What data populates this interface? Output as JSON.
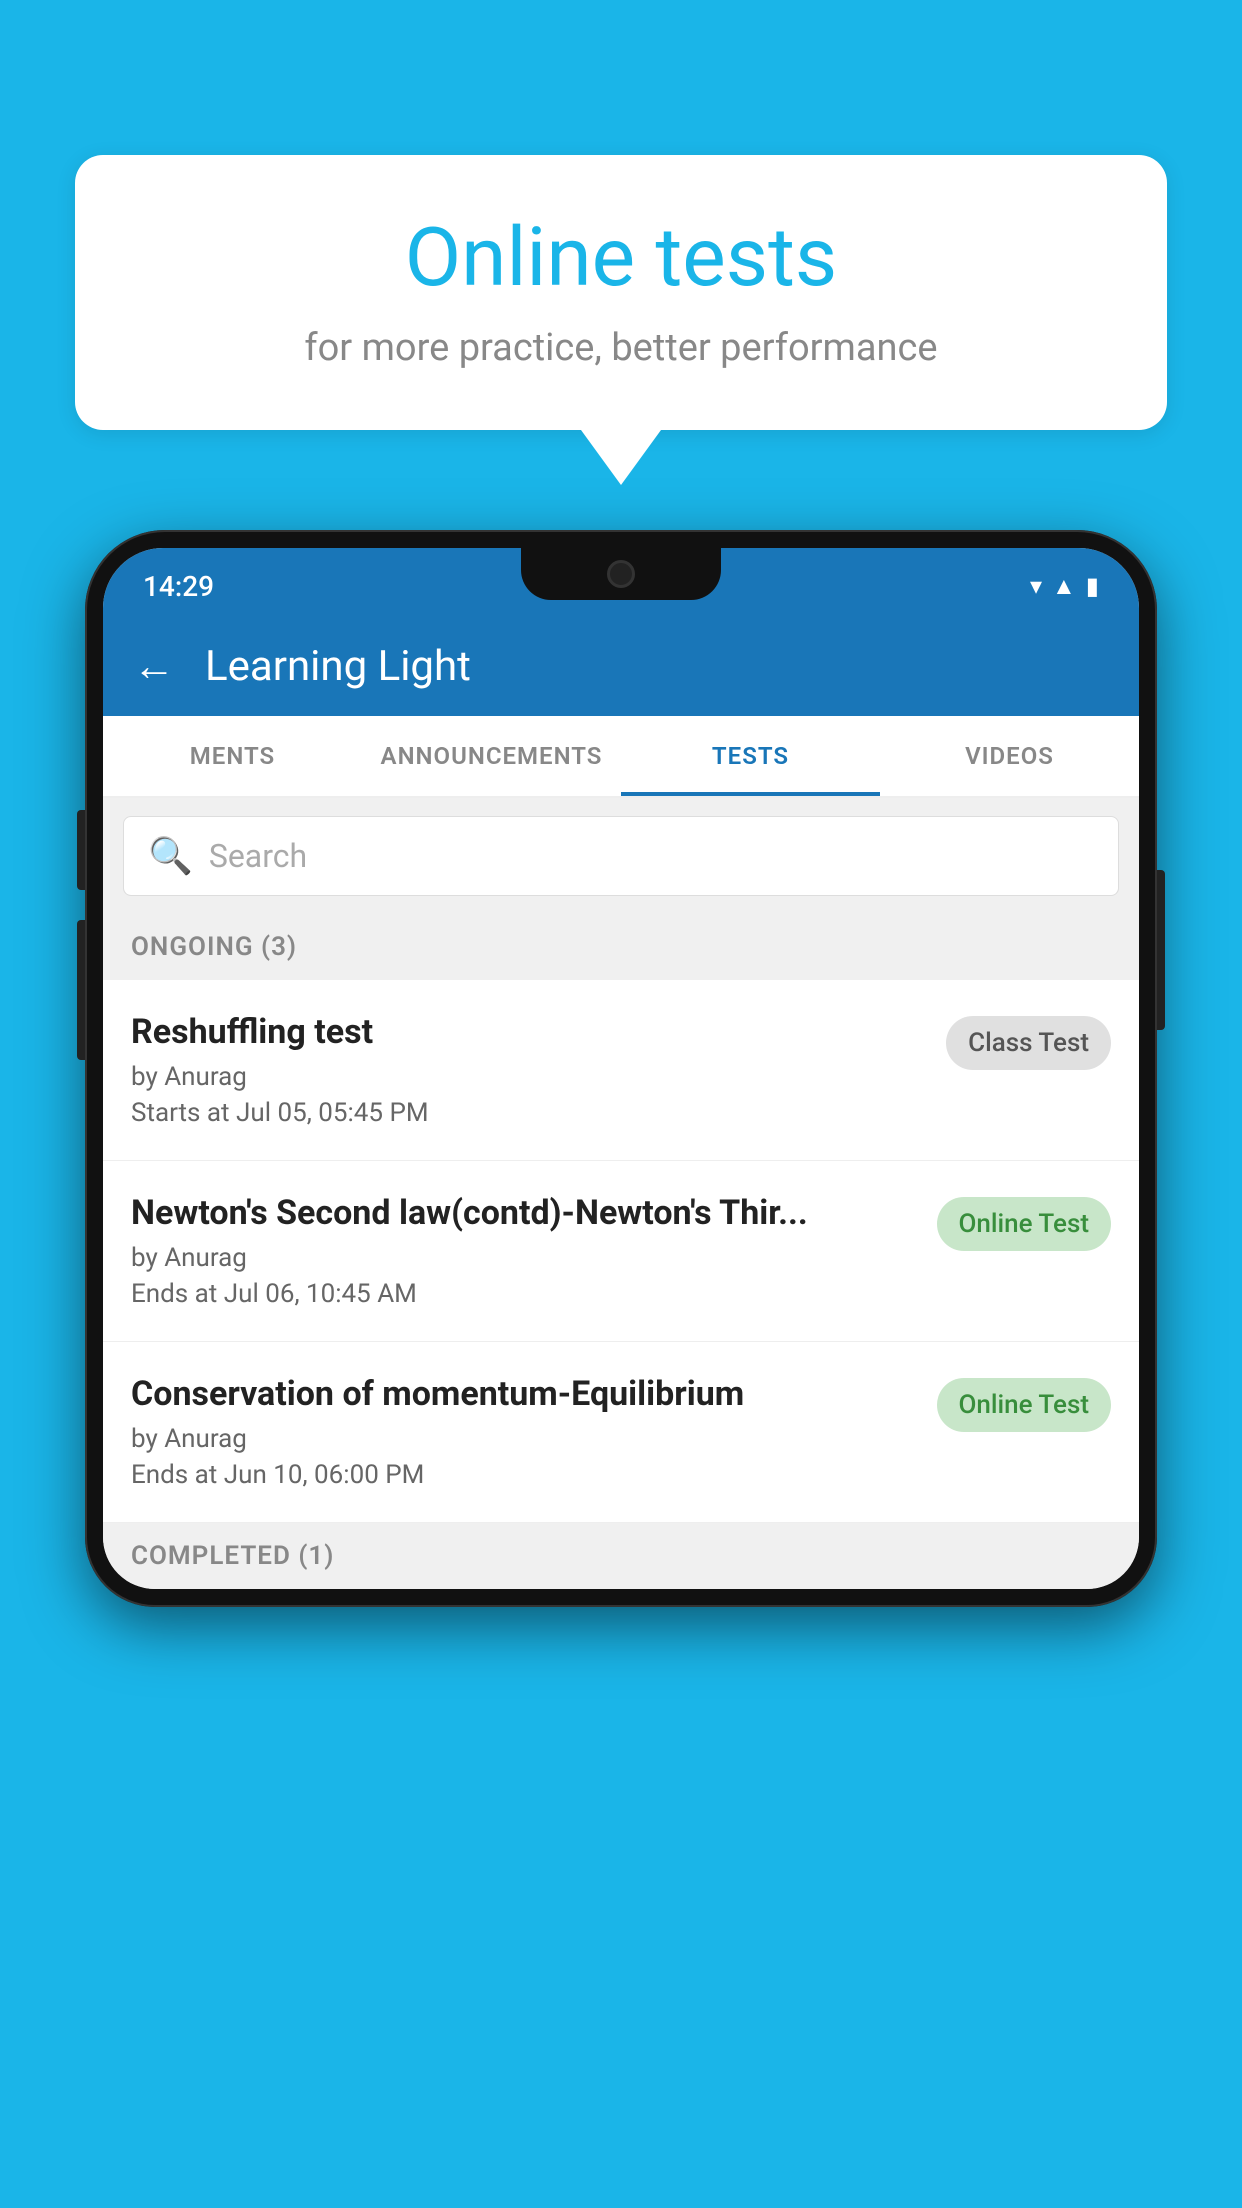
{
  "background_color": "#1ab5e8",
  "speech_bubble": {
    "title": "Online tests",
    "subtitle": "for more practice, better performance"
  },
  "phone": {
    "status_bar": {
      "time": "14:29",
      "icons": [
        "wifi",
        "signal",
        "battery"
      ]
    },
    "header": {
      "title": "Learning Light",
      "back_label": "←"
    },
    "tabs": [
      {
        "label": "MENTS",
        "active": false
      },
      {
        "label": "ANNOUNCEMENTS",
        "active": false
      },
      {
        "label": "TESTS",
        "active": true
      },
      {
        "label": "VIDEOS",
        "active": false
      }
    ],
    "search": {
      "placeholder": "Search"
    },
    "ongoing_section": {
      "label": "ONGOING (3)"
    },
    "tests": [
      {
        "name": "Reshuffling test",
        "author": "by Anurag",
        "time_label": "Starts at",
        "time": "Jul 05, 05:45 PM",
        "badge": "Class Test",
        "badge_type": "class"
      },
      {
        "name": "Newton's Second law(contd)-Newton's Thir...",
        "author": "by Anurag",
        "time_label": "Ends at",
        "time": "Jul 06, 10:45 AM",
        "badge": "Online Test",
        "badge_type": "online"
      },
      {
        "name": "Conservation of momentum-Equilibrium",
        "author": "by Anurag",
        "time_label": "Ends at",
        "time": "Jun 10, 06:00 PM",
        "badge": "Online Test",
        "badge_type": "online"
      }
    ],
    "completed_section": {
      "label": "COMPLETED (1)"
    }
  }
}
